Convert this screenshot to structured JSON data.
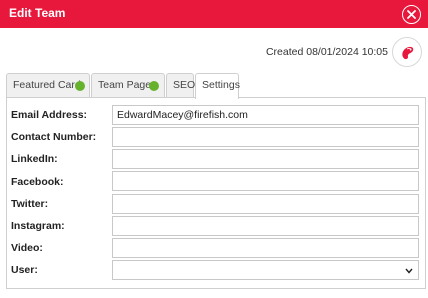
{
  "header": {
    "title": "Edit Team",
    "color": "#e8173c"
  },
  "meta": {
    "created": "Created 08/01/2024 10:05"
  },
  "tabs": [
    {
      "label": "Featured Card",
      "status": "complete",
      "active": false
    },
    {
      "label": "Team Page",
      "status": "complete",
      "active": false
    },
    {
      "label": "SEO",
      "active": false
    },
    {
      "label": "Settings",
      "active": true
    }
  ],
  "status_color": "#67b22d",
  "form": {
    "email": {
      "label": "Email Address:",
      "value": "EdwardMacey@firefish.com"
    },
    "contact": {
      "label": "Contact Number:",
      "value": ""
    },
    "linkedin": {
      "label": "LinkedIn:",
      "value": ""
    },
    "facebook": {
      "label": "Facebook:",
      "value": ""
    },
    "twitter": {
      "label": "Twitter:",
      "value": ""
    },
    "instagram": {
      "label": "Instagram:",
      "value": ""
    },
    "video": {
      "label": "Video:",
      "value": ""
    },
    "user": {
      "label": "User:",
      "value": ""
    }
  },
  "icons": {
    "close": "close-icon",
    "logo": "firefish-logo-icon",
    "dropdown": "chevron-down-icon"
  }
}
